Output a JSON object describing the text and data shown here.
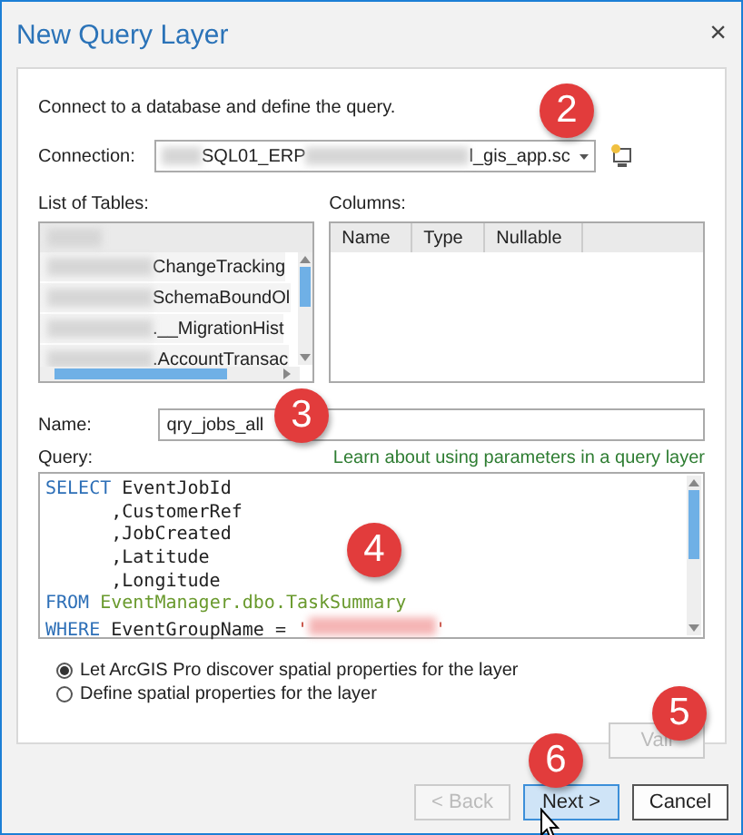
{
  "window": {
    "title": "New Query Layer",
    "close": "×"
  },
  "intro": "Connect to a database and define the query.",
  "connection": {
    "label": "Connection:",
    "parts": [
      {
        "kind": "redacted"
      },
      {
        "kind": "text",
        "text": "SQL01_ERP"
      },
      {
        "kind": "redacted"
      },
      {
        "kind": "text",
        "text": "l_gis_app.sc"
      }
    ]
  },
  "tables": {
    "label": "List of Tables:",
    "rows": [
      {
        "text": "ChangeTracking"
      },
      {
        "text": "SchemaBoundOl"
      },
      {
        "text": ".__MigrationHist"
      },
      {
        "text": ".AccountTransac"
      }
    ]
  },
  "columns": {
    "label": "Columns:",
    "headers": [
      "Name",
      "Type",
      "Nullable"
    ]
  },
  "name": {
    "label": "Name:",
    "value": "qry_jobs_all"
  },
  "query": {
    "label": "Query:",
    "link": "Learn about using parameters in a query layer",
    "lines": [
      [
        {
          "kind": "keyword",
          "text": "SELECT"
        },
        {
          "kind": "plain",
          "text": " EventJobId"
        }
      ],
      [
        {
          "kind": "plain",
          "text": "      ,CustomerRef"
        }
      ],
      [
        {
          "kind": "plain",
          "text": "      ,JobCreated"
        }
      ],
      [
        {
          "kind": "plain",
          "text": "      ,Latitude"
        }
      ],
      [
        {
          "kind": "plain",
          "text": "      ,Longitude"
        }
      ],
      [
        {
          "kind": "keyword",
          "text": "FROM"
        },
        {
          "kind": "table",
          "text": " EventManager.dbo.TaskSummary"
        }
      ],
      [
        {
          "kind": "keyword",
          "text": "WHERE"
        },
        {
          "kind": "plain",
          "text": " EventGroupName = "
        },
        {
          "kind": "string",
          "text": "'"
        },
        {
          "kind": "redacted"
        },
        {
          "kind": "string",
          "text": "'"
        }
      ]
    ]
  },
  "options": [
    {
      "label": "Let ArcGIS Pro discover spatial properties for the layer",
      "selected": true
    },
    {
      "label": "Define spatial properties for the layer",
      "selected": false
    }
  ],
  "validate": {
    "label": "Vali",
    "disabled": true
  },
  "buttons": [
    {
      "label": "< Back",
      "disabled": true,
      "hover": false
    },
    {
      "label": "Next >",
      "disabled": false,
      "hover": true
    },
    {
      "label": "Cancel",
      "disabled": false,
      "hover": false
    }
  ],
  "badges": [
    "2",
    "3",
    "4",
    "5",
    "6"
  ]
}
